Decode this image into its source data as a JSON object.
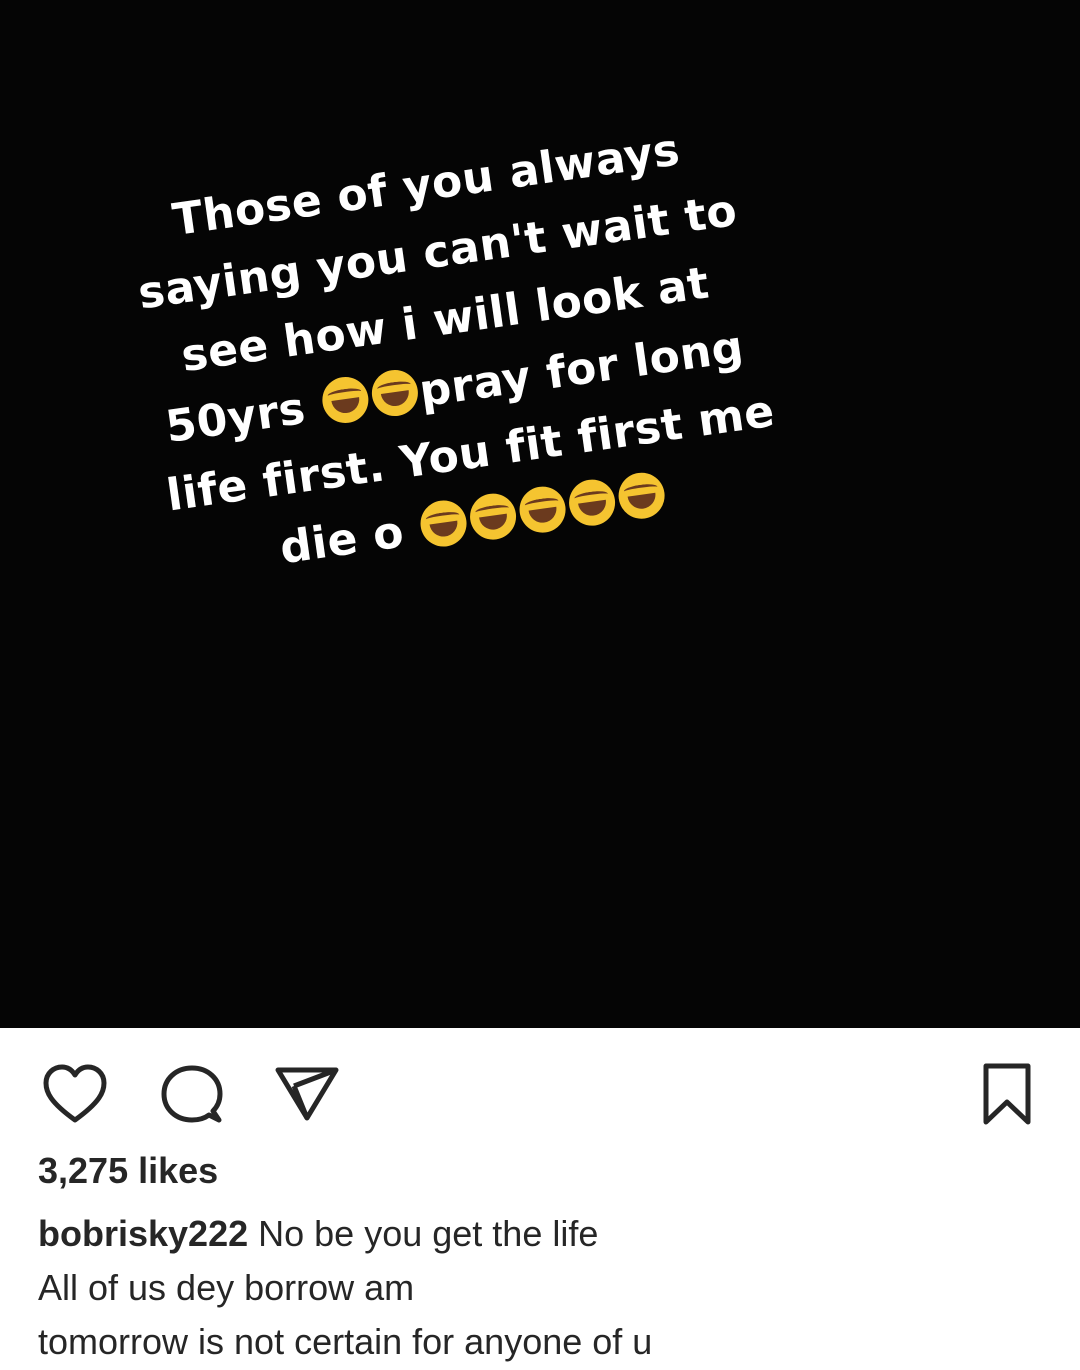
{
  "post": {
    "image": {
      "background_color": "#050505",
      "text_color": "#ffffff",
      "emoji_name": "face-with-tears-of-joy",
      "lines": [
        {
          "parts": [
            {
              "text": "Those of you always"
            }
          ]
        },
        {
          "parts": [
            {
              "text": "saying you can't wait to"
            }
          ]
        },
        {
          "parts": [
            {
              "text": "see how i will look at"
            }
          ]
        },
        {
          "parts": [
            {
              "text": "50yrs "
            },
            {
              "emoji": 2
            },
            {
              "text": "pray for long"
            }
          ]
        },
        {
          "parts": [
            {
              "text": "life first. You fit first me"
            }
          ]
        },
        {
          "parts": [
            {
              "text": "die o "
            },
            {
              "emoji": 5
            }
          ]
        }
      ]
    },
    "actions": {
      "like_icon": "heart-outline-icon",
      "comment_icon": "comment-bubble-icon",
      "share_icon": "paper-plane-icon",
      "save_icon": "bookmark-outline-icon"
    },
    "likes_text": "3,275 likes",
    "caption": {
      "username": "bobrisky222",
      "first_line": "No be you get the life",
      "lines": [
        "All of us dey borrow am",
        "tomorrow is not certain for anyone of u"
      ]
    }
  }
}
